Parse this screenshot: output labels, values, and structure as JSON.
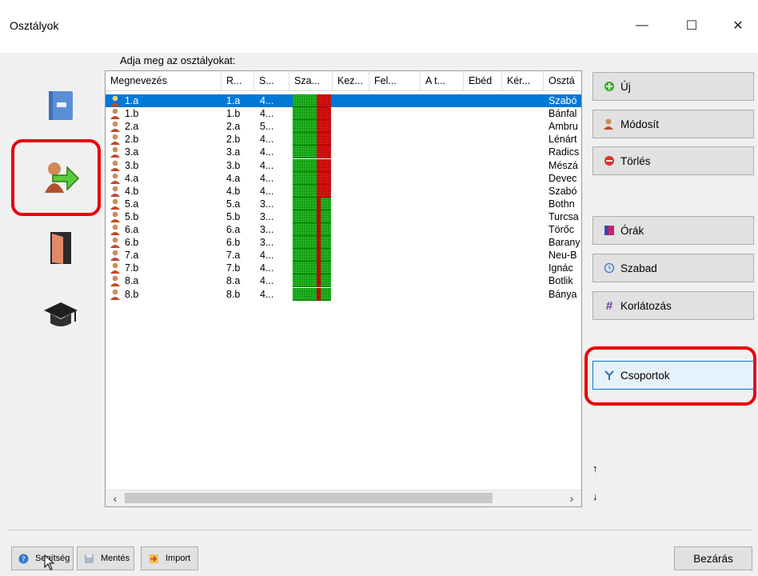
{
  "window": {
    "title": "Osztályok",
    "minimize": "—",
    "maximize": "☐",
    "close": "✕"
  },
  "prompt": "Adja meg az osztályokat:",
  "columns": [
    "Megnevezés",
    "R...",
    "S...",
    "Sza...",
    "Kez...",
    "Fel...",
    "A t...",
    "Ebéd",
    "Kér...",
    "Osztá"
  ],
  "rows": [
    {
      "name": "1.a",
      "r": "1.a",
      "s": "4...",
      "teacher": "Szabó",
      "grid": "red",
      "selected": true
    },
    {
      "name": "1.b",
      "r": "1.b",
      "s": "4...",
      "teacher": "Bánfal",
      "grid": "red"
    },
    {
      "name": "2.a",
      "r": "2.a",
      "s": "5...",
      "teacher": "Ambru",
      "grid": "red"
    },
    {
      "name": "2.b",
      "r": "2.b",
      "s": "4...",
      "teacher": "Lénárt",
      "grid": "red"
    },
    {
      "name": "3.a",
      "r": "3.a",
      "s": "4...",
      "teacher": "Radics",
      "grid": "red"
    },
    {
      "name": "3.b",
      "r": "3.b",
      "s": "4...",
      "teacher": "Mészá",
      "grid": "red"
    },
    {
      "name": "4.a",
      "r": "4.a",
      "s": "4...",
      "teacher": "Devec",
      "grid": "red"
    },
    {
      "name": "4.b",
      "r": "4.b",
      "s": "4...",
      "teacher": "Szabó",
      "grid": "red"
    },
    {
      "name": "5.a",
      "r": "5.a",
      "s": "3...",
      "teacher": "Bothn",
      "grid": "green"
    },
    {
      "name": "5.b",
      "r": "5.b",
      "s": "3...",
      "teacher": "Turcsa",
      "grid": "green"
    },
    {
      "name": "6.a",
      "r": "6.a",
      "s": "3...",
      "teacher": "Törőc",
      "grid": "green"
    },
    {
      "name": "6.b",
      "r": "6.b",
      "s": "3...",
      "teacher": "Barany",
      "grid": "green"
    },
    {
      "name": "7.a",
      "r": "7.a",
      "s": "4...",
      "teacher": "Neu-B",
      "grid": "green"
    },
    {
      "name": "7.b",
      "r": "7.b",
      "s": "4...",
      "teacher": "Ignác",
      "grid": "green"
    },
    {
      "name": "8.a",
      "r": "8.a",
      "s": "4...",
      "teacher": "Botlik",
      "grid": "green"
    },
    {
      "name": "8.b",
      "r": "8.b",
      "s": "4...",
      "teacher": "Bánya",
      "grid": "green"
    }
  ],
  "actions": {
    "new": "Új",
    "modify": "Módosít",
    "delete": "Törlés",
    "lessons": "Órák",
    "free": "Szabad",
    "constraints": "Korlátozás",
    "groups": "Csoportok"
  },
  "arrows": {
    "up": "↑",
    "down": "↓"
  },
  "scroll": {
    "left": "‹",
    "right": "›"
  },
  "bottom": {
    "help": "Segítség",
    "save": "Mentés",
    "import": "Import",
    "close": "Bezárás"
  },
  "colors": {
    "accent": "#0078d7",
    "highlight": "#e8000b",
    "green": "#00b400",
    "red": "#c00000"
  },
  "icons": {
    "sidebar": [
      "book-icon",
      "class-arrow-icon",
      "door-icon",
      "graduation-cap-icon"
    ]
  }
}
